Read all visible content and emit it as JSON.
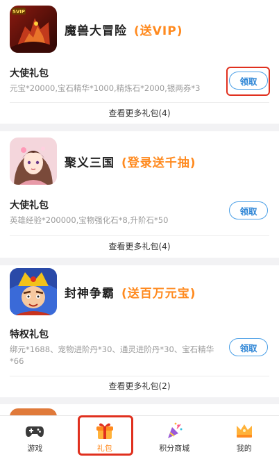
{
  "games": [
    {
      "name": "魔兽大冒险",
      "promo": "(送VIP)",
      "pack_title": "大使礼包",
      "pack_desc": "元宝*20000,宝石精华*1000,精炼石*2000,银两券*3",
      "claim_label": "领取",
      "more_label": "查看更多礼包(4)",
      "icon": "dragon-game-icon",
      "icon_badge": "5VIP"
    },
    {
      "name": "聚义三国",
      "promo": "(登录送千抽)",
      "pack_title": "大使礼包",
      "pack_desc": "英雄经验*200000,宝物强化石*8,升阶石*50",
      "claim_label": "领取",
      "more_label": "查看更多礼包(4)",
      "icon": "heroine-game-icon"
    },
    {
      "name": "封神争霸",
      "promo": "(送百万元宝)",
      "pack_title": "特权礼包",
      "pack_desc": "绑元*1688、宠物进阶丹*30、通灵进阶丹*30、宝石精华*66",
      "claim_label": "领取",
      "more_label": "查看更多礼包(2)",
      "icon": "warrior-game-icon"
    }
  ],
  "tabbar": {
    "items": [
      {
        "label": "游戏",
        "icon": "gamepad-icon"
      },
      {
        "label": "礼包",
        "icon": "gift-icon",
        "active": true
      },
      {
        "label": "积分商城",
        "icon": "party-popper-icon"
      },
      {
        "label": "我的",
        "icon": "crown-icon"
      }
    ]
  },
  "colors": {
    "promo": "#ff8a1f",
    "button_border": "#4a9fe6",
    "highlight": "#e0301e",
    "active_tab": "#ff8a1f"
  }
}
